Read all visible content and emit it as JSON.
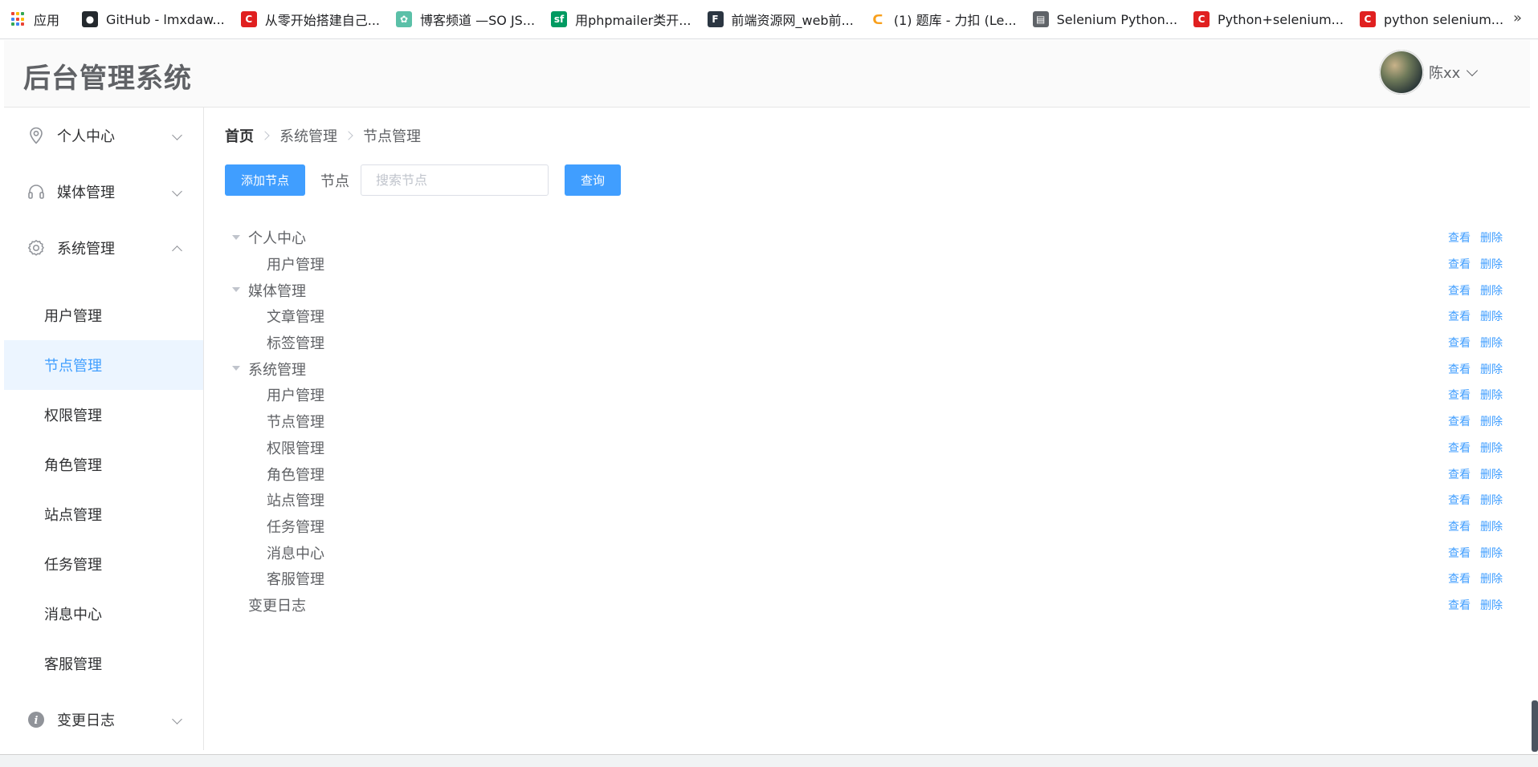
{
  "bookmarks": {
    "apps_label": "应用",
    "items": [
      {
        "label": "GitHub - lmxdaw...",
        "icon": "github-icon",
        "color": "#24292e",
        "glyph": "●"
      },
      {
        "label": "从零开始搭建自己...",
        "icon": "csdn-icon",
        "color": "#e02020",
        "glyph": "C"
      },
      {
        "label": "博客频道 —SO JS...",
        "icon": "gear-icon",
        "color": "#5bc0a8",
        "glyph": "✿"
      },
      {
        "label": "用phpmailer类开...",
        "icon": "sf-icon",
        "color": "#009a61",
        "glyph": "sf"
      },
      {
        "label": "前端资源网_web前...",
        "icon": "frontend-icon",
        "color": "#2b3642",
        "glyph": "F"
      },
      {
        "label": "(1) 题库 - 力扣 (Le...",
        "icon": "leetcode-icon",
        "color": "#ffffff",
        "glyph": "ᑕ"
      },
      {
        "label": "Selenium Python...",
        "icon": "doc-icon",
        "color": "#5f6368",
        "glyph": "▤"
      },
      {
        "label": "Python+selenium...",
        "icon": "csdn-icon",
        "color": "#e02020",
        "glyph": "C"
      },
      {
        "label": "python selenium...",
        "icon": "csdn-icon",
        "color": "#e02020",
        "glyph": "C"
      }
    ],
    "more": "»"
  },
  "header": {
    "title": "后台管理系统",
    "username": "陈xx"
  },
  "sidebar": {
    "menus": [
      {
        "label": "个人中心",
        "icon": "location-icon"
      },
      {
        "label": "媒体管理",
        "icon": "headset-icon"
      },
      {
        "label": "系统管理",
        "icon": "settings-icon"
      }
    ],
    "sub_items": [
      {
        "label": "用户管理"
      },
      {
        "label": "节点管理"
      },
      {
        "label": "权限管理"
      },
      {
        "label": "角色管理"
      },
      {
        "label": "站点管理"
      },
      {
        "label": "任务管理"
      },
      {
        "label": "消息中心"
      },
      {
        "label": "客服管理"
      }
    ],
    "last_menu": {
      "label": "变更日志",
      "icon": "info-icon"
    }
  },
  "breadcrumb": [
    "首页",
    "系统管理",
    "节点管理"
  ],
  "toolbar": {
    "add_label": "添加节点",
    "field_label": "节点",
    "search_placeholder": "搜索节点",
    "query_label": "查询"
  },
  "tree": {
    "view_label": "查看",
    "delete_label": "删除",
    "nodes": [
      {
        "label": "个人中心",
        "level": 0,
        "expandable": true
      },
      {
        "label": "用户管理",
        "level": 1
      },
      {
        "label": "媒体管理",
        "level": 0,
        "expandable": true
      },
      {
        "label": "文章管理",
        "level": 1
      },
      {
        "label": "标签管理",
        "level": 1
      },
      {
        "label": "系统管理",
        "level": 0,
        "expandable": true
      },
      {
        "label": "用户管理",
        "level": 1
      },
      {
        "label": "节点管理",
        "level": 1
      },
      {
        "label": "权限管理",
        "level": 1
      },
      {
        "label": "角色管理",
        "level": 1
      },
      {
        "label": "站点管理",
        "level": 1
      },
      {
        "label": "任务管理",
        "level": 1
      },
      {
        "label": "消息中心",
        "level": 1
      },
      {
        "label": "客服管理",
        "level": 1
      },
      {
        "label": "变更日志",
        "level": 0,
        "expandable": false
      }
    ]
  },
  "colors": {
    "accent": "#409eff",
    "active_bg": "#ecf5ff",
    "text": "#303133",
    "muted": "#606266"
  }
}
